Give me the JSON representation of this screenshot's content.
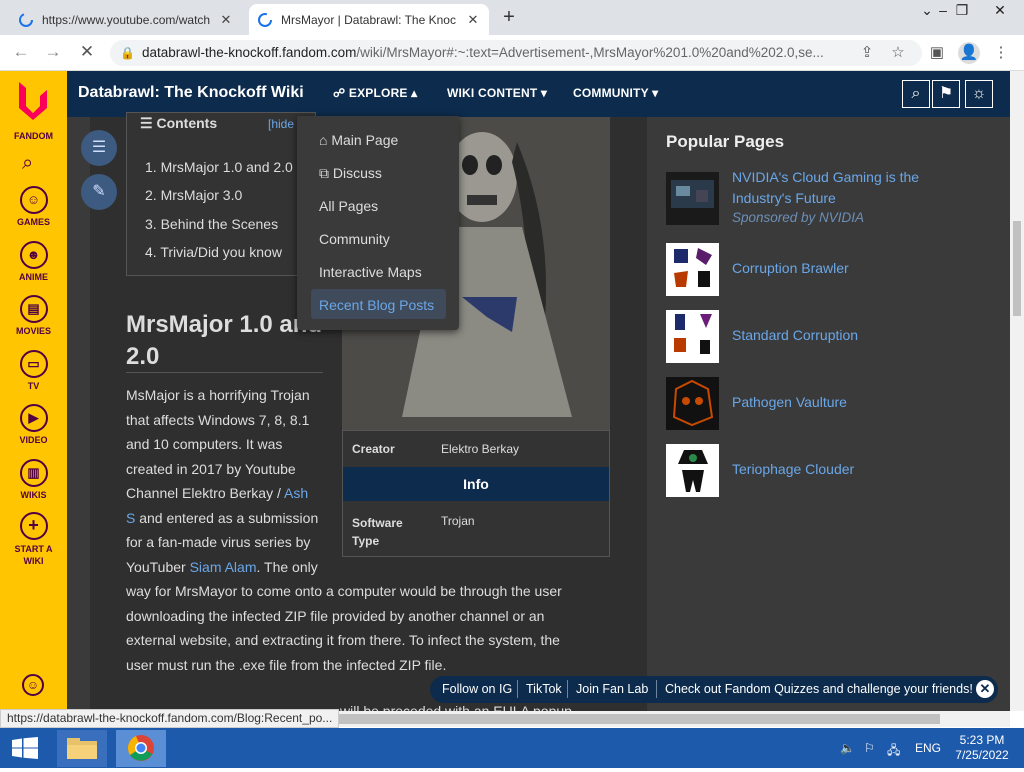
{
  "browser": {
    "tabs": [
      {
        "title": "https://www.youtube.com/watch",
        "active": false
      },
      {
        "title": "MrsMayor | Databrawl: The Knoc",
        "active": true
      }
    ],
    "url_host": "databrawl-the-knockoff.fandom.com",
    "url_path": "/wiki/MrsMayor#:~:text=Advertisement-,MrsMayor%201.0%20and%202.0,se...",
    "status_url": "https://databrawl-the-knockoff.fandom.com/Blog:Recent_po..."
  },
  "fandom_bar": {
    "logo_label": "FANDOM",
    "items": [
      {
        "label": "GAMES",
        "icon": "gamepad-icon"
      },
      {
        "label": "ANIME",
        "icon": "anime-icon"
      },
      {
        "label": "MOVIES",
        "icon": "movie-icon"
      },
      {
        "label": "TV",
        "icon": "tv-icon"
      },
      {
        "label": "VIDEO",
        "icon": "video-icon"
      },
      {
        "label": "WIKIS",
        "icon": "wikis-icon"
      },
      {
        "label": "START A WIKI",
        "icon": "plus-icon"
      }
    ]
  },
  "wiki": {
    "name": "Databrawl: The Knockoff Wiki",
    "nav": [
      "EXPLORE",
      "WIKI CONTENT",
      "COMMUNITY"
    ]
  },
  "explore_menu": [
    "Main Page",
    "Discuss",
    "All Pages",
    "Community",
    "Interactive Maps",
    "Recent Blog Posts"
  ],
  "toc": {
    "title": "Contents",
    "hide": "[hide",
    "items": [
      "1.  MrsMajor 1.0 and 2.0",
      "2.  MrsMajor 3.0",
      "3.  Behind the Scenes",
      "4.  Trivia/Did you know"
    ]
  },
  "article": {
    "heading_line1": "MrsMajor 1.0 and",
    "heading_line2": "2.0",
    "p1": [
      "MsMajor is a horrifying Trojan",
      "that affects Windows 7, 8, 8.1",
      "and 10 computers. It was",
      "created in 2017 by Youtube"
    ],
    "p1_line5_pre": "Channel Elektro Berkay / ",
    "p1_link1a": "Ash",
    "p1_link1b": "S",
    "p1_line6_post": " and entered as a submission",
    "p1_line7": "for a fan-made virus series by",
    "p1_line8_pre": "YouTuber ",
    "p1_link2": "Siam Alam",
    "p1_line8_post": ". The only",
    "p1_rest": [
      "way for MrsMayor to come onto a computer would be through the user",
      "downloading the infected ZIP file provided by another channel or an",
      "external website, and extracting it from there. To infect the system, the",
      "user must run the .exe file from the infected ZIP file."
    ],
    "below_text": "will be preceded with an EULA popup"
  },
  "infobox": {
    "creator_label": "Creator",
    "creator_value": "Elektro Berkay",
    "info_header": "Info",
    "software_label_1": "Software",
    "software_label_2": "Type",
    "software_value": "Trojan"
  },
  "popular": {
    "title": "Popular Pages",
    "items": [
      {
        "lines": [
          "NVIDIA's Cloud Gaming is the",
          "Industry's Future"
        ],
        "sponsor": "Sponsored by NVIDIA"
      },
      {
        "lines": [
          "Corruption Brawler"
        ]
      },
      {
        "lines": [
          "Standard Corruption"
        ]
      },
      {
        "lines": [
          "Pathogen Vaulture"
        ]
      },
      {
        "lines": [
          "Teriophage Clouder"
        ]
      }
    ]
  },
  "fan_bar": [
    "Follow on IG",
    "TikTok",
    "Join Fan Lab",
    "Check out Fandom Quizzes and challenge your friends!"
  ],
  "taskbar": {
    "lang": "ENG",
    "time": "5:23 PM",
    "date": "7/25/2022"
  }
}
